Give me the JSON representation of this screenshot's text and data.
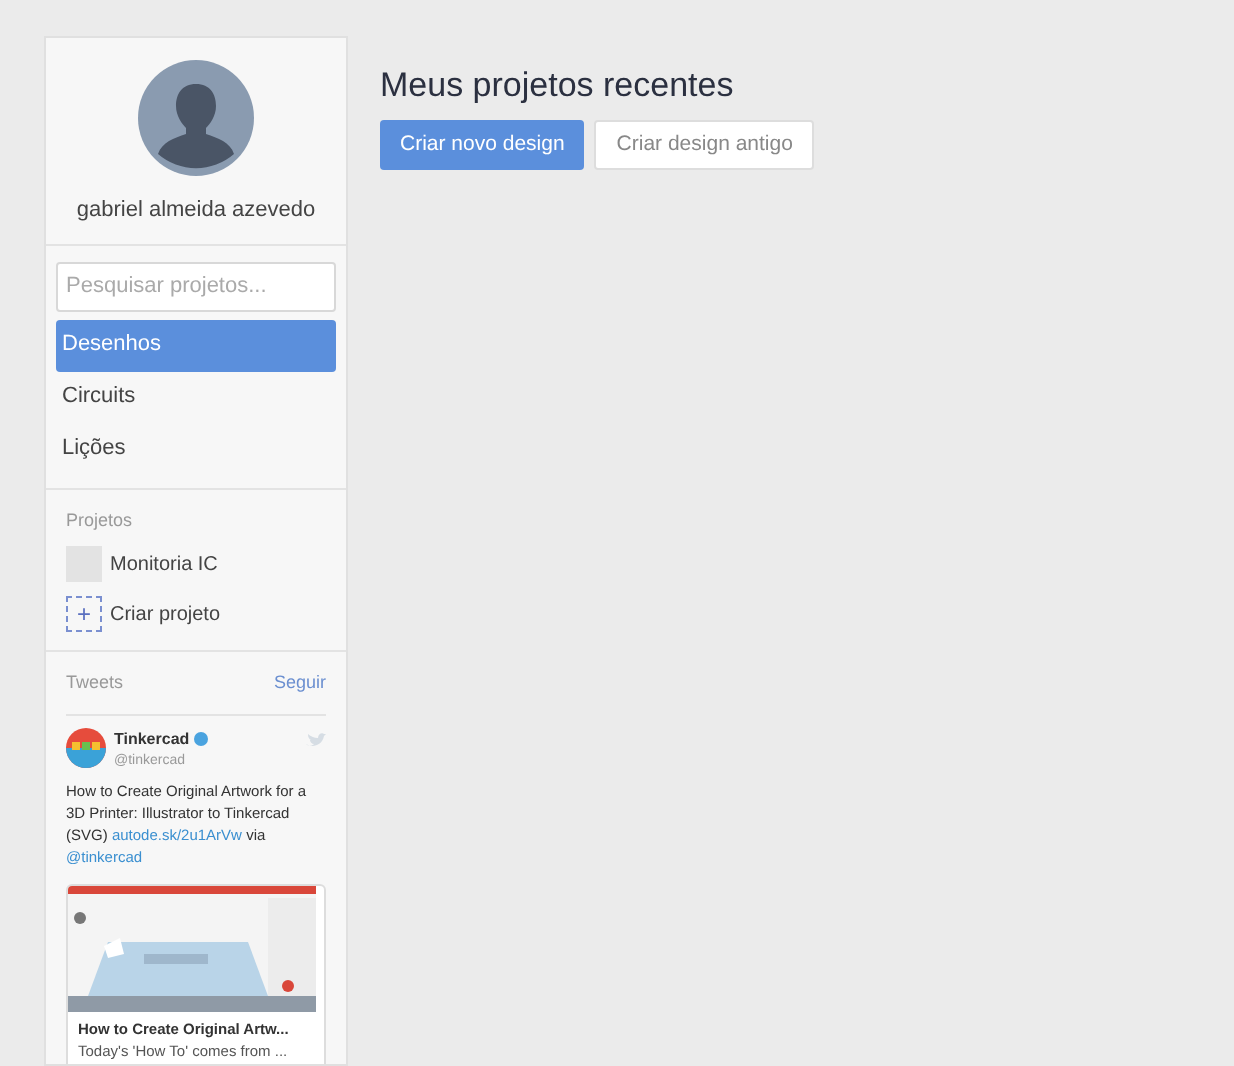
{
  "user": {
    "name": "gabriel almeida azevedo"
  },
  "search": {
    "placeholder": "Pesquisar projetos..."
  },
  "nav": [
    {
      "label": "Desenhos",
      "selected": true
    },
    {
      "label": "Circuits",
      "selected": false
    },
    {
      "label": "Lições",
      "selected": false
    }
  ],
  "projects": {
    "title": "Projetos",
    "items": [
      {
        "label": "Monitoria IC",
        "kind": "project"
      },
      {
        "label": "Criar projeto",
        "kind": "create",
        "icon": "+"
      }
    ]
  },
  "tweets": {
    "title": "Tweets",
    "follow": "Seguir",
    "tweet": {
      "author": "Tinkercad",
      "verified": true,
      "handle": "@tinkercad",
      "text": "How to Create Original Artwork for a 3D Printer: Illustrator to Tinkercad (SVG)",
      "link": "autode.sk/2u1ArVw",
      "via": "via",
      "mention": "@tinkercad",
      "card": {
        "kind": "picture",
        "title": "How to Create Original Artw...",
        "description": "Today's 'How To' comes from ..."
      }
    }
  },
  "main": {
    "title": "Meus projetos recentes",
    "buttons": [
      {
        "label": "Criar novo design",
        "primary": true
      },
      {
        "label": "Criar design antigo",
        "primary": false
      }
    ]
  }
}
